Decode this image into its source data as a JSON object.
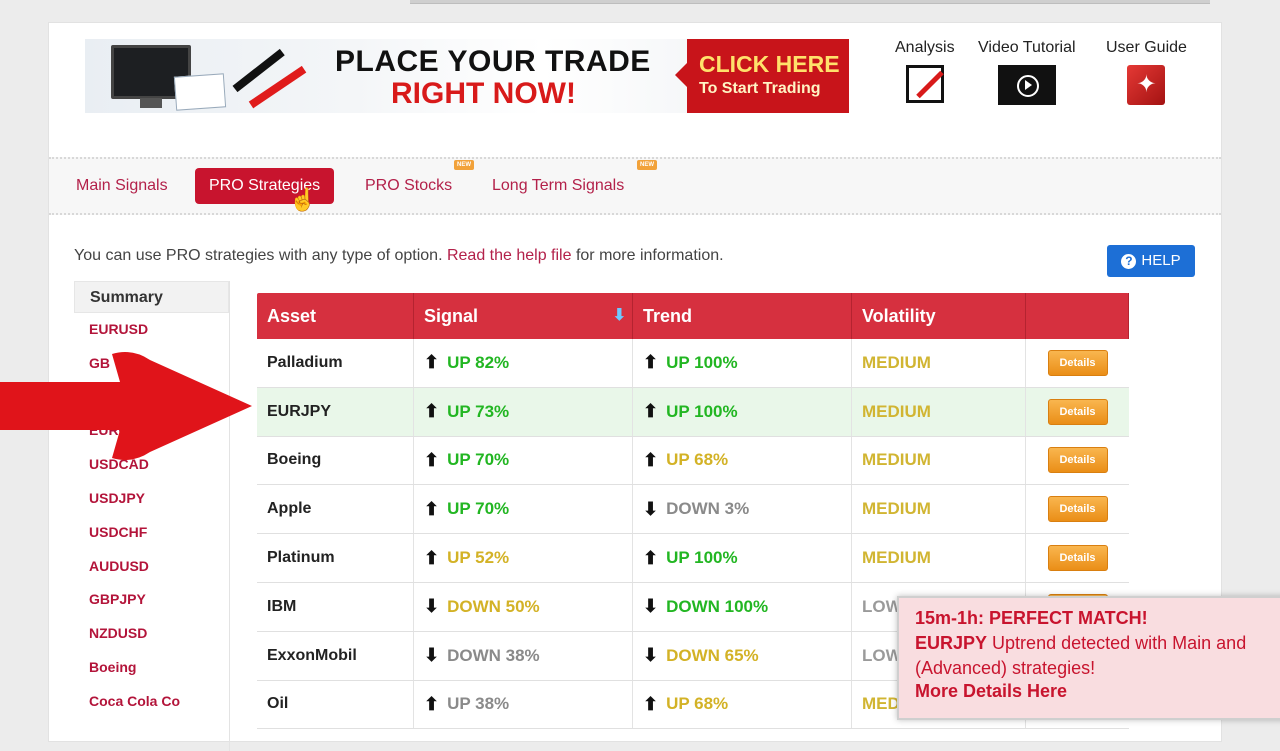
{
  "banner": {
    "headline_line1": "PLACE YOUR TRADE",
    "headline_line2": "RIGHT NOW!",
    "cta_line1": "CLICK HERE",
    "cta_line2": "To Start Trading"
  },
  "tools": [
    {
      "label": "Analysis",
      "icon": "analysis-icon"
    },
    {
      "label": "Video Tutorial",
      "icon": "video-icon"
    },
    {
      "label": "User Guide",
      "icon": "pdf-icon"
    }
  ],
  "nav": {
    "tabs": [
      "Main Signals",
      "PRO Strategies",
      "PRO Stocks",
      "Long Term Signals"
    ],
    "active": "PRO Strategies",
    "new_badge": "NEW"
  },
  "intro": {
    "text1": "You can use PRO strategies with any type of option.",
    "link": "Read the help file",
    "text2": "for more information."
  },
  "help_button": "HELP",
  "sidebar": {
    "header": "Summary",
    "items": [
      "EURUSD",
      "GBPUSD",
      "USDJPY",
      "EURGBP",
      "USDCAD",
      "USDJPY",
      "USDCHF",
      "AUDUSD",
      "GBPJPY",
      "NZDUSD",
      "Boeing",
      "Coca Cola Co"
    ],
    "visible_items": [
      "EURUSD",
      "GB",
      "",
      "EURG",
      "USDCAD",
      "USDJPY",
      "USDCHF",
      "AUDUSD",
      "GBPJPY",
      "NZDUSD",
      "Boeing",
      "Coca Cola Co"
    ]
  },
  "table": {
    "headers": [
      "Asset",
      "Signal",
      "Trend",
      "Volatility",
      ""
    ],
    "details_label": "Details",
    "rows": [
      {
        "asset": "Palladium",
        "signal_dir": "up",
        "signal": "UP 82%",
        "signal_color": "up",
        "trend_dir": "up",
        "trend": "UP 100%",
        "trend_color": "up",
        "volatility": "MEDIUM",
        "vol_color": "vol-med"
      },
      {
        "asset": "EURJPY",
        "signal_dir": "up",
        "signal": "UP 73%",
        "signal_color": "up",
        "trend_dir": "up",
        "trend": "UP 100%",
        "trend_color": "up",
        "volatility": "MEDIUM",
        "vol_color": "vol-med",
        "highlight": true
      },
      {
        "asset": "Boeing",
        "signal_dir": "up",
        "signal": "UP 70%",
        "signal_color": "up",
        "trend_dir": "up",
        "trend": "UP 68%",
        "trend_color": "up-y",
        "volatility": "MEDIUM",
        "vol_color": "vol-med"
      },
      {
        "asset": "Apple",
        "signal_dir": "up",
        "signal": "UP 70%",
        "signal_color": "up",
        "trend_dir": "down",
        "trend": "DOWN 3%",
        "trend_color": "dn-g",
        "volatility": "MEDIUM",
        "vol_color": "vol-med"
      },
      {
        "asset": "Platinum",
        "signal_dir": "up",
        "signal": "UP 52%",
        "signal_color": "up-y",
        "trend_dir": "up",
        "trend": "UP 100%",
        "trend_color": "up",
        "volatility": "MEDIUM",
        "vol_color": "vol-med"
      },
      {
        "asset": "IBM",
        "signal_dir": "down",
        "signal": "DOWN 50%",
        "signal_color": "dn-y",
        "trend_dir": "down",
        "trend": "DOWN 100%",
        "trend_color": "dn-gr",
        "volatility": "LOW",
        "vol_color": "vol-low"
      },
      {
        "asset": "ExxonMobil",
        "signal_dir": "down",
        "signal": "DOWN 38%",
        "signal_color": "dn-g",
        "trend_dir": "down",
        "trend": "DOWN 65%",
        "trend_color": "dn-y",
        "volatility": "LOW",
        "vol_color": "vol-low"
      },
      {
        "asset": "Oil",
        "signal_dir": "up",
        "signal": "UP 38%",
        "signal_color": "dn-g",
        "trend_dir": "up",
        "trend": "UP 68%",
        "trend_color": "up-y",
        "volatility": "MEDIUM",
        "vol_color": "vol-med"
      }
    ]
  },
  "popup": {
    "title": "15m-1h: PERFECT MATCH!",
    "asset": "EURJPY",
    "body1": "Uptrend detected with Main and",
    "body2": "(Advanced) strategies!",
    "link": "More Details Here"
  }
}
